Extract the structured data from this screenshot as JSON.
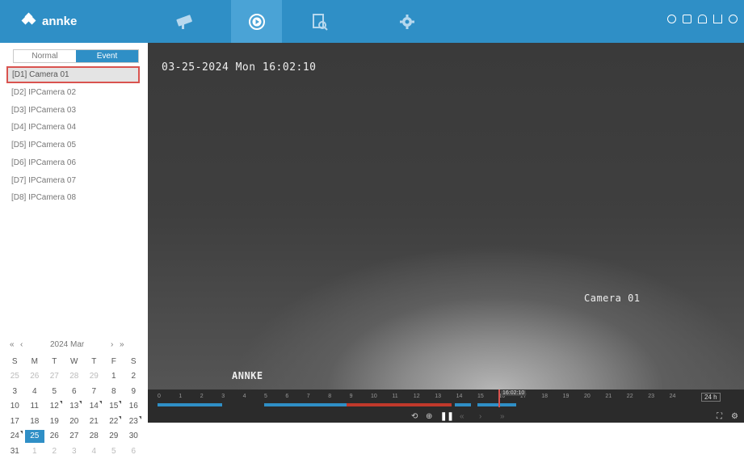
{
  "brand": {
    "logo_text": "annke"
  },
  "nav": {
    "tabs": [
      "live-view-icon",
      "playback-icon",
      "search-icon",
      "settings-icon"
    ],
    "active": 1
  },
  "topright": {
    "icons": [
      "info-icon",
      "home-icon",
      "bell-icon",
      "download-icon",
      "power-icon"
    ]
  },
  "mode_toggle": {
    "normal": "Normal",
    "event": "Event",
    "active": "Event"
  },
  "cameras": [
    "[D1] Camera 01",
    "[D2] IPCamera 02",
    "[D3] IPCamera 03",
    "[D4] IPCamera 04",
    "[D5] IPCamera 05",
    "[D6] IPCamera 06",
    "[D7] IPCamera 07",
    "[D8] IPCamera 08"
  ],
  "calendar": {
    "title": "2024 Mar",
    "prev_year": "«",
    "prev_month": "‹",
    "next_month": "›",
    "next_year": "»",
    "weekdays": [
      "S",
      "M",
      "T",
      "W",
      "T",
      "F",
      "S"
    ],
    "weeks": [
      [
        "25",
        "26",
        "27",
        "28",
        "29",
        "1",
        "2"
      ],
      [
        "3",
        "4",
        "5",
        "6",
        "7",
        "8",
        "9"
      ],
      [
        "10",
        "11",
        "12",
        "13",
        "14",
        "15",
        "16"
      ],
      [
        "17",
        "18",
        "19",
        "20",
        "21",
        "22",
        "23"
      ],
      [
        "24",
        "25",
        "26",
        "27",
        "28",
        "29",
        "30"
      ],
      [
        "31",
        "1",
        "2",
        "3",
        "4",
        "5",
        "6"
      ]
    ],
    "today": "25"
  },
  "video": {
    "timestamp": "03-25-2024 Mon 16:02:10",
    "camera_label": "Camera 01",
    "watermark": "ANNKE"
  },
  "timeline": {
    "hours": [
      "0",
      "1",
      "2",
      "3",
      "4",
      "5",
      "6",
      "7",
      "8",
      "9",
      "10",
      "11",
      "12",
      "13",
      "14",
      "15",
      "16",
      "17",
      "18",
      "19",
      "20",
      "21",
      "22",
      "23",
      "24"
    ],
    "cursor": "16:02:10",
    "range": "24 h",
    "accent": "#2f8fc6",
    "event_color": "#c0392b"
  }
}
